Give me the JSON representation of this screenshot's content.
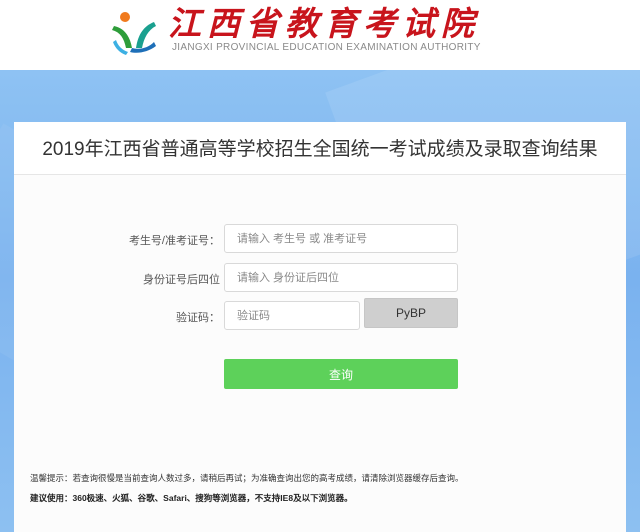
{
  "header": {
    "logo_title": "江西省教育考试院",
    "logo_subtitle": "JIANGXI PROVINCIAL EDUCATION EXAMINATION AUTHORITY",
    "logo_icon": "jx-logo-icon"
  },
  "card": {
    "title": "2019年江西省普通高等学校招生全国统一考试成绩及录取查询结果"
  },
  "form": {
    "exam_id": {
      "label": "考生号/准考证号：",
      "placeholder": "请输入 考生号 或 准考证号",
      "value": ""
    },
    "id_last4": {
      "label": "身份证号后四位",
      "placeholder": "请输入 身份证后四位",
      "value": ""
    },
    "captcha": {
      "label": "验证码：",
      "placeholder": "验证码",
      "value": "",
      "image_text": "PyBP"
    },
    "submit_label": "查询"
  },
  "footer": {
    "notice": "温馨提示：若查询很慢是当前查询人数过多，请稍后再试；为准确查询出您的高考成绩，请清除浏览器缓存后查询。",
    "advice": "建议使用：360极速、火狐、谷歌、Safari、搜狗等浏览器，不支持IE8及以下浏览器。"
  },
  "colors": {
    "brand_red": "#c8141c",
    "banner_blue": "#7ab2ef",
    "submit_green": "#5dd15a",
    "captcha_gray": "#cfcfcf"
  }
}
